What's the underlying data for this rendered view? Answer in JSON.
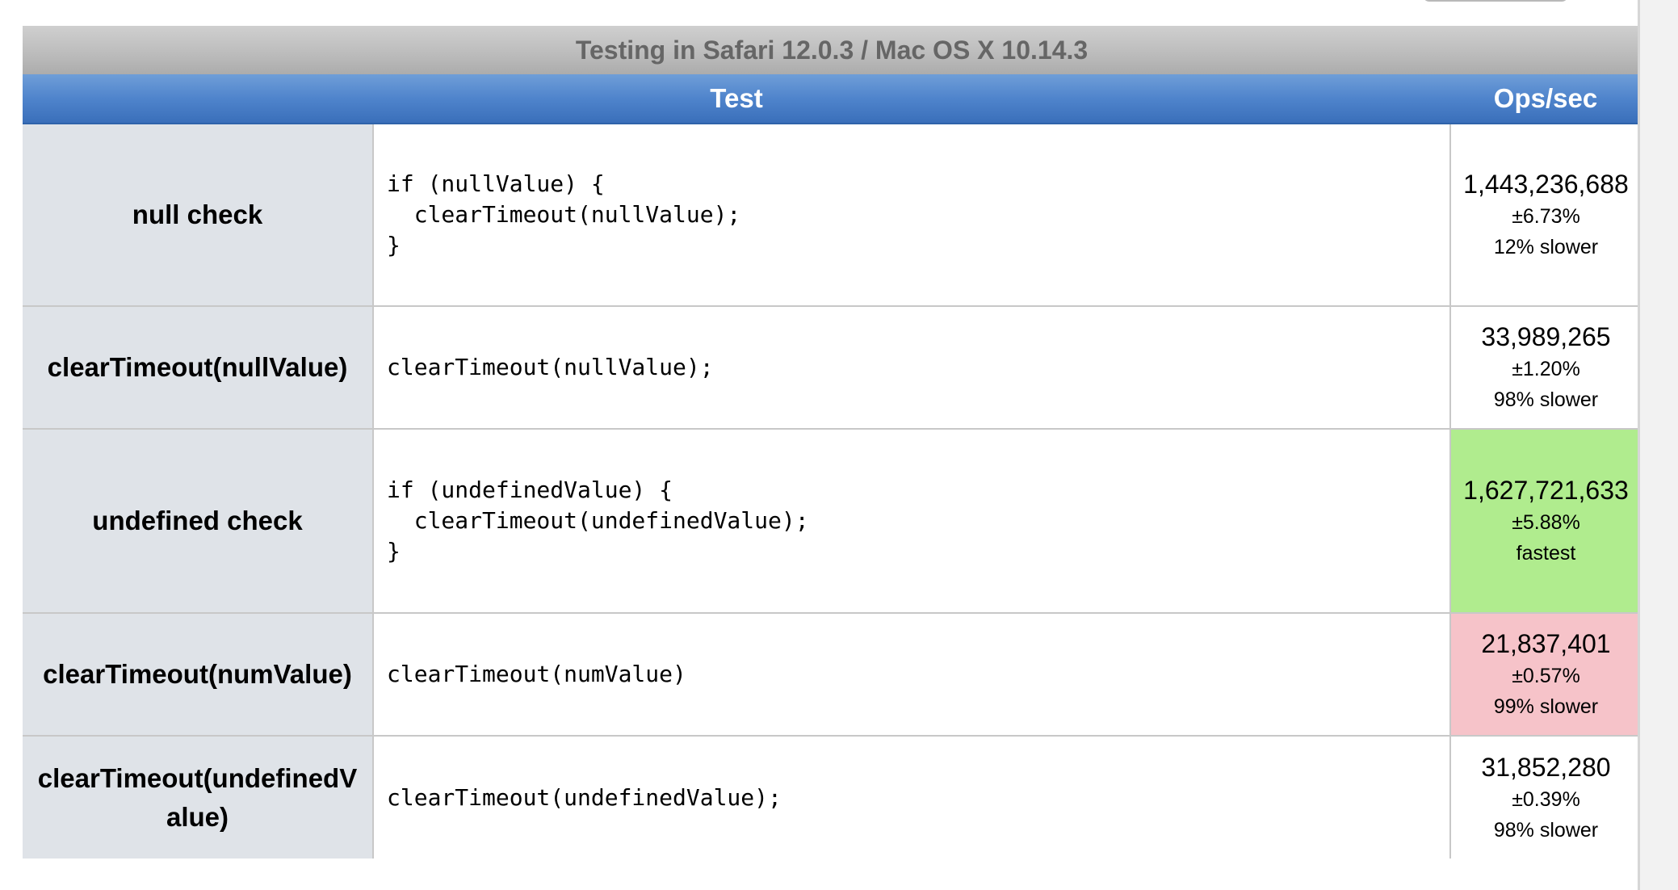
{
  "caption": "Testing in Safari 12.0.3 / Mac OS X 10.14.3",
  "headers": {
    "test": "Test",
    "ops": "Ops/sec"
  },
  "tests": [
    {
      "title": "null check",
      "code": "if (nullValue) {\n  clearTimeout(nullValue);\n}",
      "ops": "1,443,236,688",
      "error": "±6.73%",
      "note": "12% slower",
      "status": "normal"
    },
    {
      "title": "clearTimeout(nullValue)",
      "code": "clearTimeout(nullValue);",
      "ops": "33,989,265",
      "error": "±1.20%",
      "note": "98% slower",
      "status": "normal"
    },
    {
      "title": "undefined check",
      "code": "if (undefinedValue) {\n  clearTimeout(undefinedValue);\n}",
      "ops": "1,627,721,633",
      "error": "±5.88%",
      "note": "fastest",
      "status": "fastest",
      "status_color": "#b0ec8e"
    },
    {
      "title": "clearTimeout(numValue)",
      "code": "clearTimeout(numValue)",
      "ops": "21,837,401",
      "error": "±0.57%",
      "note": "99% slower",
      "status": "slowest",
      "status_color": "#f6c3c9"
    },
    {
      "title": "clearTimeout(undefinedValue)",
      "code": "clearTimeout(undefinedValue);",
      "ops": "31,852,280",
      "error": "±0.39%",
      "note": "98% slower",
      "status": "normal"
    }
  ]
}
